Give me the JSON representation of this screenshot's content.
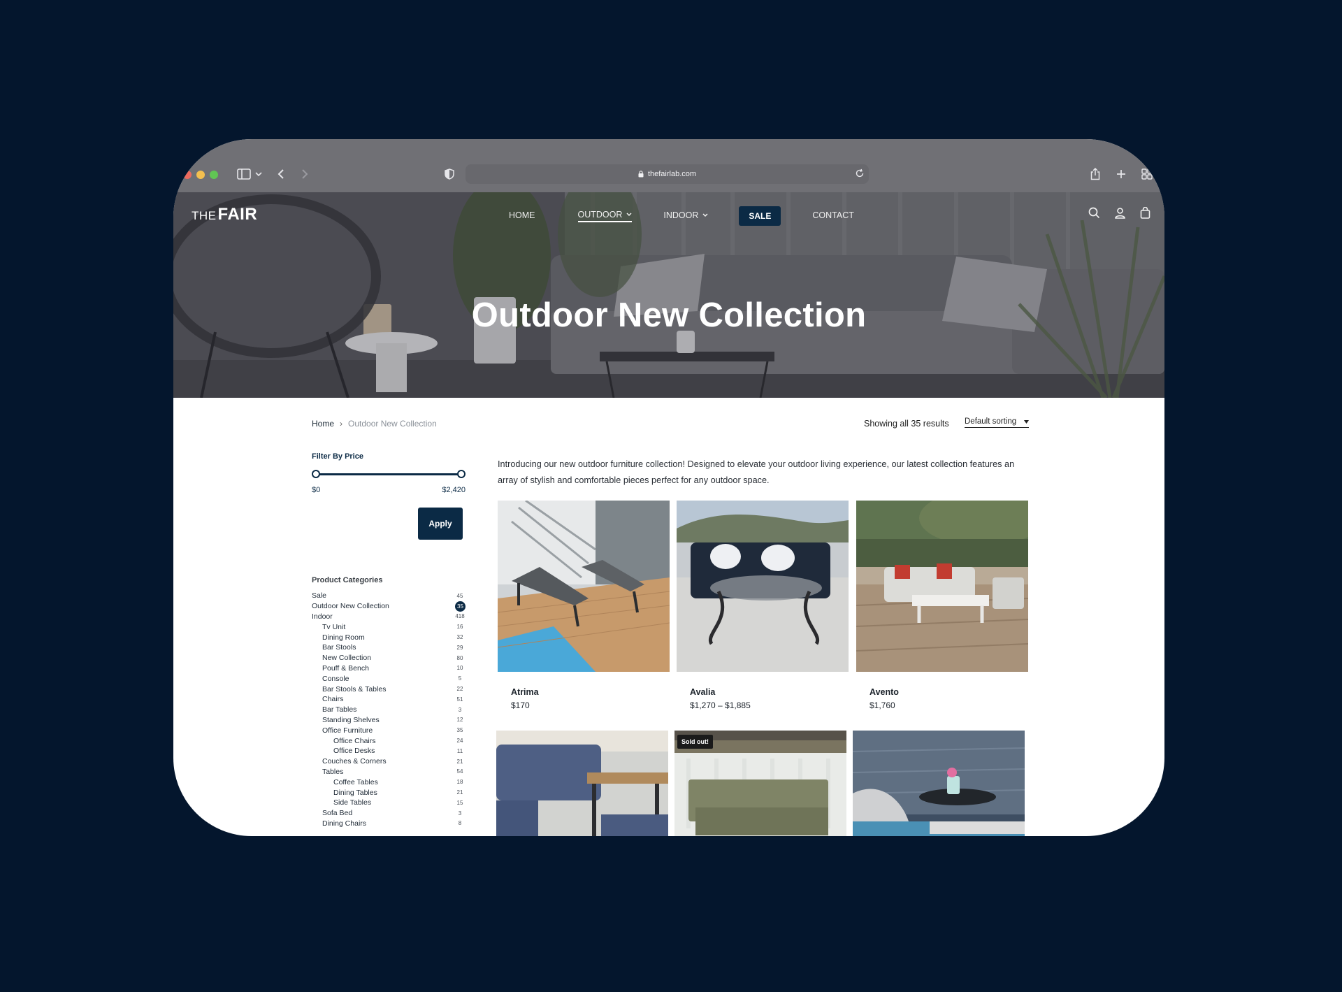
{
  "browser": {
    "url": "thefairlab.com"
  },
  "site": {
    "logo_the": "THE",
    "logo_fair": "FAIR",
    "nav": [
      {
        "label": "HOME"
      },
      {
        "label": "OUTDOOR"
      },
      {
        "label": "INDOOR"
      },
      {
        "label": "SALE"
      },
      {
        "label": "CONTACT"
      }
    ],
    "hero_title": "Outdoor New Collection"
  },
  "breadcrumb": {
    "home": "Home",
    "separator": "›",
    "current": "Outdoor New Collection"
  },
  "results": {
    "text": "Showing all 35 results",
    "sort_label": "Default sorting"
  },
  "filter": {
    "title": "Filter By Price",
    "min": "$0",
    "max": "$2,420",
    "apply_label": "Apply",
    "range_fraction": [
      0,
      1
    ]
  },
  "categories": {
    "title": "Product Categories",
    "items": [
      {
        "label": "Sale",
        "count": "45",
        "level": 0
      },
      {
        "label": "Outdoor New Collection",
        "count": "35",
        "level": 0,
        "active": true
      },
      {
        "label": "Indoor",
        "count": "418",
        "level": 0
      },
      {
        "label": "Tv Unit",
        "count": "16",
        "level": 1
      },
      {
        "label": "Dining Room",
        "count": "32",
        "level": 1
      },
      {
        "label": "Bar Stools",
        "count": "29",
        "level": 1
      },
      {
        "label": "New Collection",
        "count": "80",
        "level": 1
      },
      {
        "label": "Pouff & Bench",
        "count": "10",
        "level": 1
      },
      {
        "label": "Console",
        "count": "5",
        "level": 1
      },
      {
        "label": "Bar Stools & Tables",
        "count": "22",
        "level": 1
      },
      {
        "label": "Chairs",
        "count": "51",
        "level": 1
      },
      {
        "label": "Bar Tables",
        "count": "3",
        "level": 1
      },
      {
        "label": "Standing Shelves",
        "count": "12",
        "level": 1
      },
      {
        "label": "Office Furniture",
        "count": "35",
        "level": 1
      },
      {
        "label": "Office Chairs",
        "count": "24",
        "level": 2
      },
      {
        "label": "Office Desks",
        "count": "11",
        "level": 2
      },
      {
        "label": "Couches & Corners",
        "count": "21",
        "level": 1
      },
      {
        "label": "Tables",
        "count": "54",
        "level": 1
      },
      {
        "label": "Coffee Tables",
        "count": "18",
        "level": 2
      },
      {
        "label": "Dining Tables",
        "count": "21",
        "level": 2
      },
      {
        "label": "Side Tables",
        "count": "15",
        "level": 2
      },
      {
        "label": "Sofa Bed",
        "count": "3",
        "level": 1
      },
      {
        "label": "Dining Chairs",
        "count": "8",
        "level": 1
      }
    ]
  },
  "intro": "Introducing our new outdoor furniture collection! Designed to elevate your outdoor living experience, our latest collection features an array of stylish and comfortable pieces perfect for any outdoor space.",
  "products": [
    {
      "name": "Atrima",
      "price": "$170"
    },
    {
      "name": "Avalia",
      "price": "$1,270 – $1,885"
    },
    {
      "name": "Avento",
      "price": "$1,760"
    },
    {
      "name": "",
      "price": ""
    },
    {
      "name": "",
      "price": "",
      "badge": "Sold out!"
    },
    {
      "name": "",
      "price": ""
    }
  ],
  "colors": {
    "page_bg": "#04162d",
    "brand_navy": "#0b2a45",
    "toolbar": "#707075"
  }
}
